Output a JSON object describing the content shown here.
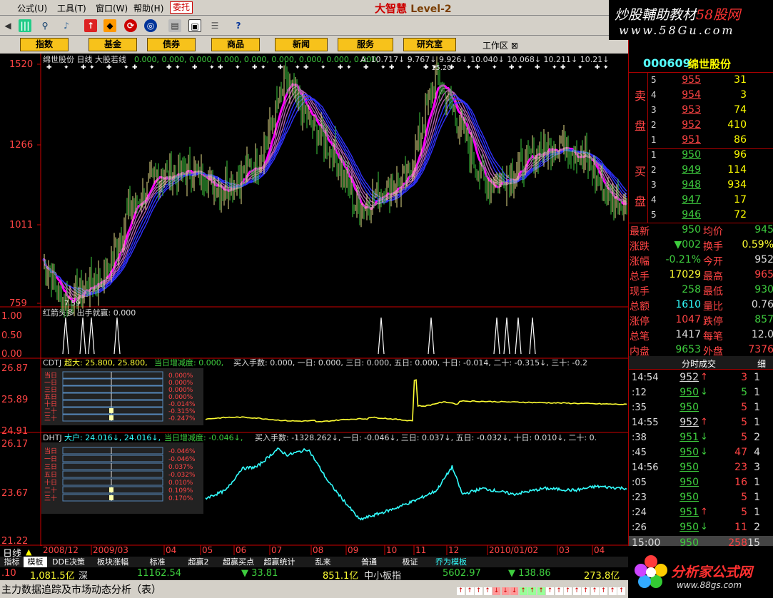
{
  "menu": [
    "公式(U)",
    "工具(T)",
    "窗口(W)",
    "帮助(H)"
  ],
  "trade_button": "委托",
  "brand": {
    "name": "大智慧",
    "level": "Level-2"
  },
  "watermark_top": {
    "line1_a": "炒股輔助教材",
    "line1_b": "58股网",
    "line2": "www.58Gu.com"
  },
  "nav": [
    "指数",
    "基金",
    "债券",
    "商品",
    "新闻",
    "服务",
    "研究室"
  ],
  "workarea": "工作区",
  "main_chart": {
    "title": "绵世股份 日线 大股若线",
    "values_text": "0.000, 0.000, 0.000, 0.000, 0.000, 0.000, 0.000, 0.000, 0.000,",
    "a_label": "A: 10.717↓  9.767↓ 9.926↓ 10.040↓ 10.068↓ 10.211↓ 10.21↓",
    "y_ticks": [
      "1520",
      "1266",
      "1011",
      "759"
    ],
    "high_label": "15.20",
    "low_label": "7.59",
    "color_up": "#e7e08a",
    "color_down": "#3ecd3e",
    "color_ma": "#ff00ff",
    "color_band": "#3030ff"
  },
  "signal": {
    "title": "红箭头多  出手就赢: 0.000",
    "y_ticks": [
      "1.00",
      "0.50",
      "0.00"
    ],
    "pulses_at_day": [
      16,
      28,
      34,
      52,
      237,
      272,
      318,
      325,
      333,
      343
    ]
  },
  "cdtj": {
    "title_a": "CDTJ",
    "title_b": "超大: 25.800, 25.800,",
    "title_c": "当日增减度: 0.000,",
    "title_d": "买入手数: 0.000, 一日: 0.000, 三日: 0.000, 五日: 0.000, 十日: -0.014, 二十: -0.315↓, 三十: -0.2",
    "y_ticks": [
      "26.87",
      "25.89",
      "24.91"
    ],
    "legend_labels": [
      "当日",
      "一日",
      "三日",
      "五日",
      "十日",
      "二十",
      "三十"
    ],
    "legend_vals": [
      "0.000%",
      "0.000%",
      "0.000%",
      "0.000%",
      "-0.014%",
      "-0.315%",
      "-0.247%"
    ],
    "color": "#ffff33"
  },
  "dhtj": {
    "title_a": "DHTJ",
    "title_b": "大户: 24.016↓, 24.016↓,",
    "title_c": "当日增减度: -0.046↓,",
    "title_d": "买入手数: -1328.262↓, 一日: -0.046↓, 三日: 0.037↓, 五日: -0.032↓, 十日: 0.010↓, 二十: 0.",
    "y_ticks": [
      "26.17",
      "23.67",
      "21.22"
    ],
    "legend_labels": [
      "当日",
      "一日",
      "三日",
      "五日",
      "十日",
      "二十",
      "三十"
    ],
    "legend_vals": [
      "-0.046%",
      "-0.046%",
      "0.037%",
      "-0.032%",
      "0.010%",
      "0.109%",
      "0.170%"
    ],
    "color": "#33ffff"
  },
  "x_axis": [
    "2008/12",
    "2009/03",
    "04",
    "05",
    "06",
    "07",
    "08",
    "09",
    "10",
    "11",
    "12",
    "2010/01/02",
    "03",
    "04"
  ],
  "stock": {
    "code": "000609",
    "name": "绵世股份"
  },
  "orderbook": {
    "sell_label": [
      "卖",
      "盘"
    ],
    "buy_label": [
      "买",
      "盘"
    ],
    "sell": [
      {
        "lvl": "5",
        "price": "955",
        "vol": "31"
      },
      {
        "lvl": "4",
        "price": "954",
        "vol": "3"
      },
      {
        "lvl": "3",
        "price": "953",
        "vol": "74"
      },
      {
        "lvl": "2",
        "price": "952",
        "vol": "410"
      },
      {
        "lvl": "1",
        "price": "951",
        "vol": "86"
      }
    ],
    "buy": [
      {
        "lvl": "1",
        "price": "950",
        "vol": "96"
      },
      {
        "lvl": "2",
        "price": "949",
        "vol": "114"
      },
      {
        "lvl": "3",
        "price": "948",
        "vol": "934"
      },
      {
        "lvl": "4",
        "price": "947",
        "vol": "17"
      },
      {
        "lvl": "5",
        "price": "946",
        "vol": "72"
      }
    ]
  },
  "quote": [
    {
      "l1": "最新",
      "v1": "950",
      "c1": "#3ecd3e",
      "l2": "均价",
      "v2": "945",
      "c2": "#3ecd3e"
    },
    {
      "l1": "涨跌",
      "v1": "▼002",
      "c1": "#3ecd3e",
      "l2": "换手",
      "v2": "0.59%",
      "c2": "#ffff33"
    },
    {
      "l1": "涨幅",
      "v1": "-0.21%",
      "c1": "#3ecd3e",
      "l2": "今开",
      "v2": "952",
      "c2": "#ddd"
    },
    {
      "l1": "总手",
      "v1": "17029",
      "c1": "#ffff33",
      "l2": "最高",
      "v2": "965",
      "c2": "#ff4444"
    },
    {
      "l1": "现手",
      "v1": "258",
      "c1": "#3ecd3e",
      "l2": "最低",
      "v2": "930",
      "c2": "#3ecd3e"
    },
    {
      "l1": "总额",
      "v1": "1610",
      "c1": "#33ffff",
      "l2": "量比",
      "v2": "0.76",
      "c2": "#ddd"
    },
    {
      "l1": "涨停",
      "v1": "1047",
      "c1": "#ff4444",
      "l2": "跌停",
      "v2": "857",
      "c2": "#3ecd3e"
    },
    {
      "l1": "总笔",
      "v1": "1417",
      "c1": "#ddd",
      "l2": "每笔",
      "v2": "12.0",
      "c2": "#ddd"
    },
    {
      "l1": "内盘",
      "v1": "9653",
      "c1": "#3ecd3e",
      "l2": "外盘",
      "v2": "7376",
      "c2": "#ff4444"
    }
  ],
  "ticks_head": {
    "title": "分时成交",
    "tab": "细"
  },
  "ticks": [
    {
      "time": "14:54",
      "price": "952",
      "dir": "↑",
      "pc": "#ddd",
      "vol": "3",
      "vc": "#ff4444",
      "cnt": "1"
    },
    {
      "time": ":12",
      "price": "950",
      "dir": "↓",
      "pc": "#3ecd3e",
      "vol": "5",
      "vc": "#3ecd3e",
      "cnt": "1"
    },
    {
      "time": ":35",
      "price": "950",
      "dir": "",
      "pc": "#3ecd3e",
      "vol": "5",
      "vc": "#ff4444",
      "cnt": "1"
    },
    {
      "time": "14:55",
      "price": "952",
      "dir": "↑",
      "pc": "#ddd",
      "vol": "5",
      "vc": "#ff4444",
      "cnt": "1"
    },
    {
      "time": ":38",
      "price": "951",
      "dir": "↓",
      "pc": "#3ecd3e",
      "vol": "5",
      "vc": "#ff4444",
      "cnt": "2"
    },
    {
      "time": ":45",
      "price": "950",
      "dir": "↓",
      "pc": "#3ecd3e",
      "vol": "47",
      "vc": "#ff4444",
      "cnt": "4"
    },
    {
      "time": "14:56",
      "price": "950",
      "dir": "",
      "pc": "#3ecd3e",
      "vol": "23",
      "vc": "#ff4444",
      "cnt": "3"
    },
    {
      "time": ":05",
      "price": "950",
      "dir": "",
      "pc": "#3ecd3e",
      "vol": "16",
      "vc": "#ff4444",
      "cnt": "1"
    },
    {
      "time": ":23",
      "price": "950",
      "dir": "",
      "pc": "#3ecd3e",
      "vol": "5",
      "vc": "#ff4444",
      "cnt": "1"
    },
    {
      "time": ":24",
      "price": "951",
      "dir": "↑",
      "pc": "#3ecd3e",
      "vol": "5",
      "vc": "#ff4444",
      "cnt": "1"
    },
    {
      "time": ":26",
      "price": "950",
      "dir": "↓",
      "pc": "#3ecd3e",
      "vol": "11",
      "vc": "#ff4444",
      "cnt": "2"
    }
  ],
  "tick_last": {
    "time": "15:00",
    "price": "950",
    "vol": "258",
    "cnt": "15"
  },
  "period": "日线",
  "tabs": [
    "指标",
    "模板",
    "DDE决策",
    "板块涨幅",
    "标准",
    "超赢2",
    "超赢买点",
    "超赢统计",
    "乱来",
    "普通",
    "极证",
    "乔为模板"
  ],
  "index_bar": [
    {
      "t": ".10",
      "c": "#ff4444"
    },
    {
      "t": "1,081.5亿",
      "c": "#ffff33"
    },
    {
      "t": "深",
      "c": "#ddd"
    },
    {
      "t": "11162.54",
      "c": "#3ecd3e"
    },
    {
      "t": "▼ 33.81",
      "c": "#3ecd3e"
    },
    {
      "t": "851.1亿",
      "c": "#ffff33"
    },
    {
      "t": "中小板指",
      "c": "#ddd"
    },
    {
      "t": "5602.97",
      "c": "#3ecd3e"
    },
    {
      "t": "▼ 138.86",
      "c": "#3ecd3e"
    },
    {
      "t": "273.8亿",
      "c": "#ffff33"
    }
  ],
  "status": "主力数据追踪及市场动态分析（表）",
  "watermark_bottom": {
    "site": "分析家公式网",
    "url": "www.88gs.com"
  }
}
